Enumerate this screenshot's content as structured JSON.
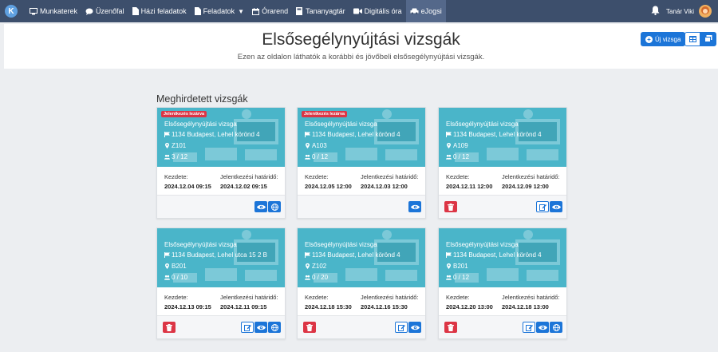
{
  "navbar": {
    "logo": "K",
    "items": [
      {
        "label": "Munkaterek",
        "icon": "monitor-icon"
      },
      {
        "label": "Üzenőfal",
        "icon": "chat-bubble-icon"
      },
      {
        "label": "Házi feladatok",
        "icon": "document-icon"
      },
      {
        "label": "Feladatok",
        "icon": "folder-icon",
        "dropdown": true
      },
      {
        "label": "Órarend",
        "icon": "calendar-icon"
      },
      {
        "label": "Tananyagtár",
        "icon": "book-icon"
      },
      {
        "label": "Digitális óra",
        "icon": "video-camera-icon"
      },
      {
        "label": "eJogsi",
        "icon": "car-icon",
        "active": true
      }
    ],
    "user_name": "Tanár Viki"
  },
  "header": {
    "title": "Elsősegélynyújtási vizsgák",
    "subtitle": "Ezen az oldalon láthatók a korábbi és jövőbeli elsősegélynyújtási vizsgák.",
    "new_button_label": "Új vizsga"
  },
  "section_title": "Meghirdetett vizsgák",
  "labels": {
    "start": "Kezdete:",
    "deadline": "Jelentkezési határidő:"
  },
  "colors": {
    "navbar": "#3d4f6c",
    "card_top": "#4ab5c9",
    "primary": "#1c75d8",
    "danger": "#dc3545"
  },
  "cards": [
    {
      "badge": "Jelentkezés lezárva",
      "title": "Elsősegélynyújtási vizsga",
      "address": "1134 Budapest, Lehel körönd 4",
      "room": "Z101",
      "count": "3 / 12",
      "start": "2024.12.04 09:15",
      "deadline": "2024.12.02 09:15",
      "actions": [
        "view",
        "globe"
      ]
    },
    {
      "badge": "Jelentkezés lezárva",
      "title": "Elsősegélynyújtási vizsga",
      "address": "1134 Budapest, Lehel körönd 4",
      "room": "A103",
      "count": "0 / 12",
      "start": "2024.12.05 12:00",
      "deadline": "2024.12.03 12:00",
      "actions": [
        "view"
      ]
    },
    {
      "badge": "",
      "title": "Elsősegélynyújtási vizsga",
      "address": "1134 Budapest, Lehel körönd 4",
      "room": "A109",
      "count": "0 / 12",
      "start": "2024.12.11 12:00",
      "deadline": "2024.12.09 12:00",
      "actions": [
        "delete",
        "edit",
        "view"
      ]
    },
    {
      "badge": "",
      "title": "Elsősegélynyújtási vizsga",
      "address": "1134 Budapest, Lehel utca 15 2 B",
      "room": "B201",
      "count": "0 / 10",
      "start": "2024.12.13 09:15",
      "deadline": "2024.12.11 09:15",
      "actions": [
        "delete",
        "edit",
        "view",
        "globe"
      ]
    },
    {
      "badge": "",
      "title": "Elsősegélynyújtási vizsga",
      "address": "1134 Budapest, Lehel körönd 4",
      "room": "Z102",
      "count": "0 / 20",
      "start": "2024.12.18 15:30",
      "deadline": "2024.12.16 15:30",
      "actions": [
        "delete",
        "edit",
        "view"
      ]
    },
    {
      "badge": "",
      "title": "Elsősegélynyújtási vizsga",
      "address": "1134 Budapest, Lehel körönd 4",
      "room": "B201",
      "count": "0 / 12",
      "start": "2024.12.20 13:00",
      "deadline": "2024.12.18 13:00",
      "actions": [
        "delete",
        "edit",
        "view",
        "globe"
      ]
    }
  ]
}
